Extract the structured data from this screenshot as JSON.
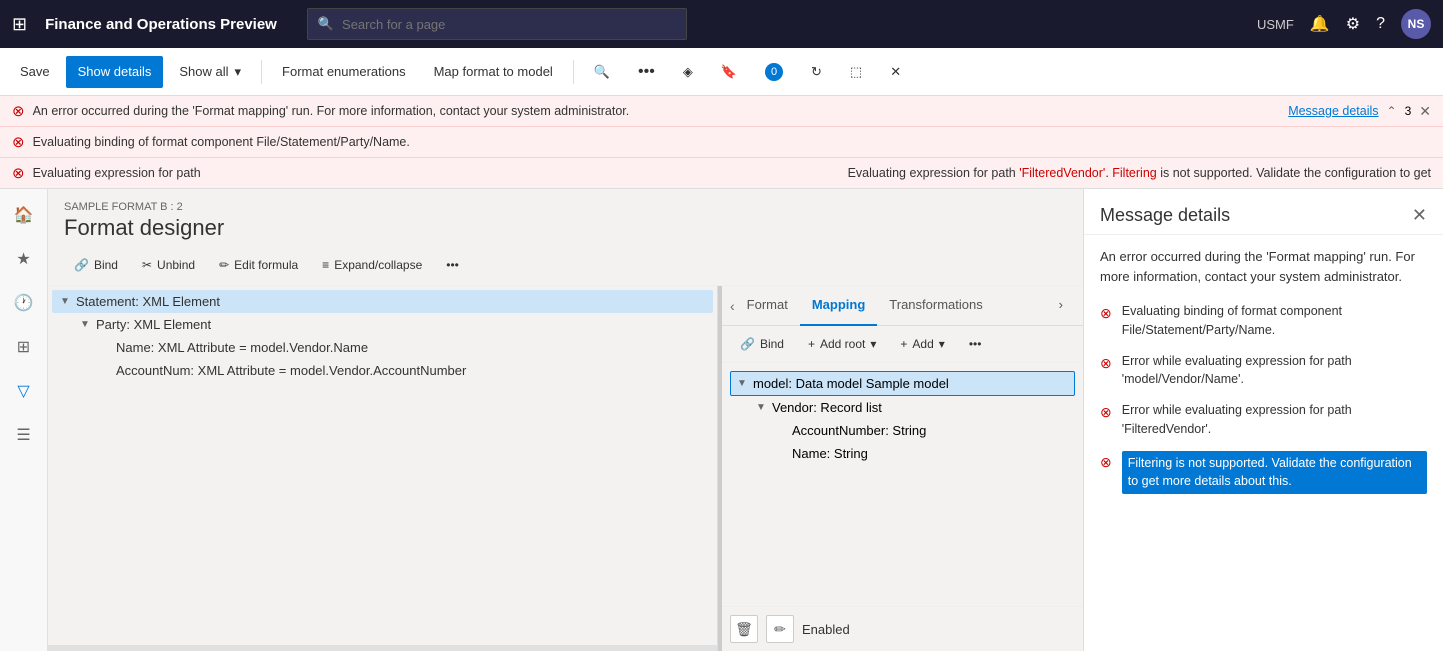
{
  "app": {
    "title": "Finance and Operations Preview",
    "env": "USMF",
    "user_initials": "NS"
  },
  "search": {
    "placeholder": "Search for a page"
  },
  "toolbar": {
    "save_label": "Save",
    "show_details_label": "Show details",
    "show_all_label": "Show all",
    "format_enumerations_label": "Format enumerations",
    "map_format_to_model_label": "Map format to model"
  },
  "errors": [
    {
      "id": "err1",
      "text": "An error occurred during the 'Format mapping' run. For more information, contact your system administrator.",
      "has_link": true,
      "link_text": "Message details",
      "count": 3
    },
    {
      "id": "err2",
      "text": "Evaluating binding of format component File/Statement/Party/Name.",
      "has_link": false
    },
    {
      "id": "err3",
      "text": "Evaluating expression for path",
      "extra_text": "Evaluating expression for path 'FilteredVendor'. Filtering is not supported. Validate the configuration to get",
      "has_link": false
    }
  ],
  "designer": {
    "subtitle": "SAMPLE FORMAT B : 2",
    "title": "Format designer"
  },
  "designer_toolbar": {
    "bind": "Bind",
    "unbind": "Unbind",
    "edit_formula": "Edit formula",
    "expand_collapse": "Expand/collapse"
  },
  "format_tree": [
    {
      "level": 0,
      "toggle": "▼",
      "label": "Statement: XML Element",
      "selected": true
    },
    {
      "level": 1,
      "toggle": "▼",
      "label": "Party: XML Element",
      "selected": false
    },
    {
      "level": 2,
      "toggle": "",
      "label": "Name: XML Attribute = model.Vendor.Name",
      "selected": false
    },
    {
      "level": 2,
      "toggle": "",
      "label": "AccountNum: XML Attribute = model.Vendor.AccountNumber",
      "selected": false
    }
  ],
  "right_pane": {
    "tab_format": "Format",
    "tab_mapping": "Mapping",
    "tab_transformations": "Transformations"
  },
  "mapping_toolbar": {
    "bind": "Bind",
    "add_root": "Add root",
    "add": "Add"
  },
  "model_tree": [
    {
      "level": 0,
      "toggle": "▼",
      "label": "model: Data model Sample model",
      "selected": true
    },
    {
      "level": 1,
      "toggle": "▼",
      "label": "Vendor: Record list",
      "selected": false
    },
    {
      "level": 2,
      "toggle": "",
      "label": "AccountNumber: String",
      "selected": false
    },
    {
      "level": 2,
      "toggle": "",
      "label": "Name: String",
      "selected": false
    }
  ],
  "bottom_controls": {
    "delete_icon": "🗑",
    "edit_icon": "✏",
    "status": "Enabled"
  },
  "message_panel": {
    "title": "Message details",
    "close_icon": "✕",
    "summary": "An error occurred during the 'Format mapping' run. For more information, contact your system administrator.",
    "items": [
      {
        "id": "mp1",
        "text": "Evaluating binding of format component File/Statement/Party/Name.",
        "highlighted": false
      },
      {
        "id": "mp2",
        "text": "Error while evaluating expression for path 'model/Vendor/Name'.",
        "highlighted": false
      },
      {
        "id": "mp3",
        "text": "Error while evaluating expression for path 'FilteredVendor'.",
        "highlighted": false
      },
      {
        "id": "mp4",
        "text": "Filtering is not supported. Validate the configuration to get more details about this.",
        "highlighted": true
      }
    ]
  }
}
